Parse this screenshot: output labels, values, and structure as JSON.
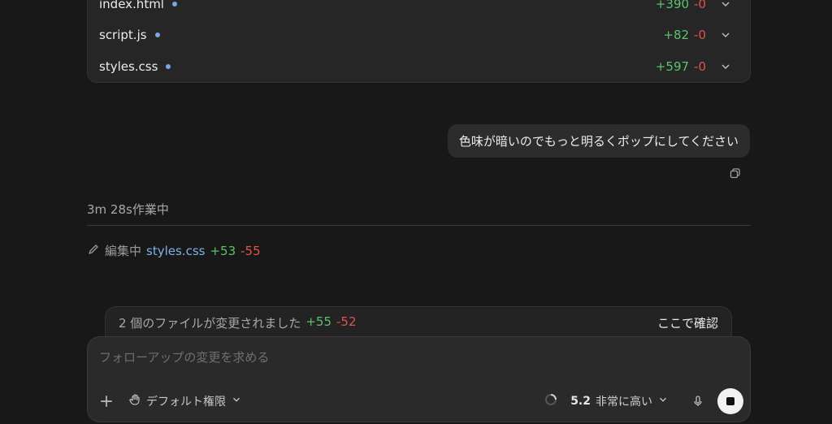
{
  "files": [
    {
      "name": "index.html",
      "added": "+390",
      "removed": "-0"
    },
    {
      "name": "script.js",
      "added": "+82",
      "removed": "-0"
    },
    {
      "name": "styles.css",
      "added": "+597",
      "removed": "-0"
    }
  ],
  "user_message": "色味が暗いのでもっと明るくポップにしてください",
  "worked": "3m 28s作業中",
  "editing": {
    "label": "編集中",
    "file": "styles.css",
    "added": "+53",
    "removed": "-55"
  },
  "summary": {
    "text": "2 個のファイルが変更されました",
    "added": "+55",
    "removed": "-52",
    "review": "ここで確認"
  },
  "composer": {
    "placeholder": "フォローアップの変更を求める",
    "permission": "デフォルト権限",
    "model_version": "5.2",
    "model_level": "非常に高い"
  },
  "colors": {
    "added": "#5cc26b",
    "removed": "#e0524c",
    "file_link": "#7fb0ea"
  }
}
